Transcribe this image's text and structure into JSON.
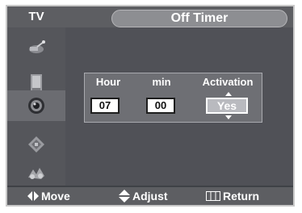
{
  "header": {
    "source_label": "TV",
    "menu_title": "Off Timer"
  },
  "sidebar": {
    "items": [
      {
        "icon": "antenna-icon",
        "active": false
      },
      {
        "icon": "speaker-icon",
        "active": false
      },
      {
        "icon": "sound-icon",
        "active": true
      },
      {
        "icon": "channel-icon",
        "active": false
      },
      {
        "icon": "setup-icon",
        "active": false
      }
    ]
  },
  "off_timer": {
    "columns": {
      "hour": "Hour",
      "min": "min",
      "activation": "Activation"
    },
    "values": {
      "hour": "07",
      "min": "00",
      "activation": "Yes"
    }
  },
  "footer": {
    "move_label": "Move",
    "adjust_label": "Adjust",
    "return_label": "Return"
  },
  "colors": {
    "background": "#3f4146",
    "bar": "#5d5e62",
    "panel": "#6e6f74",
    "text": "#ffffff"
  }
}
